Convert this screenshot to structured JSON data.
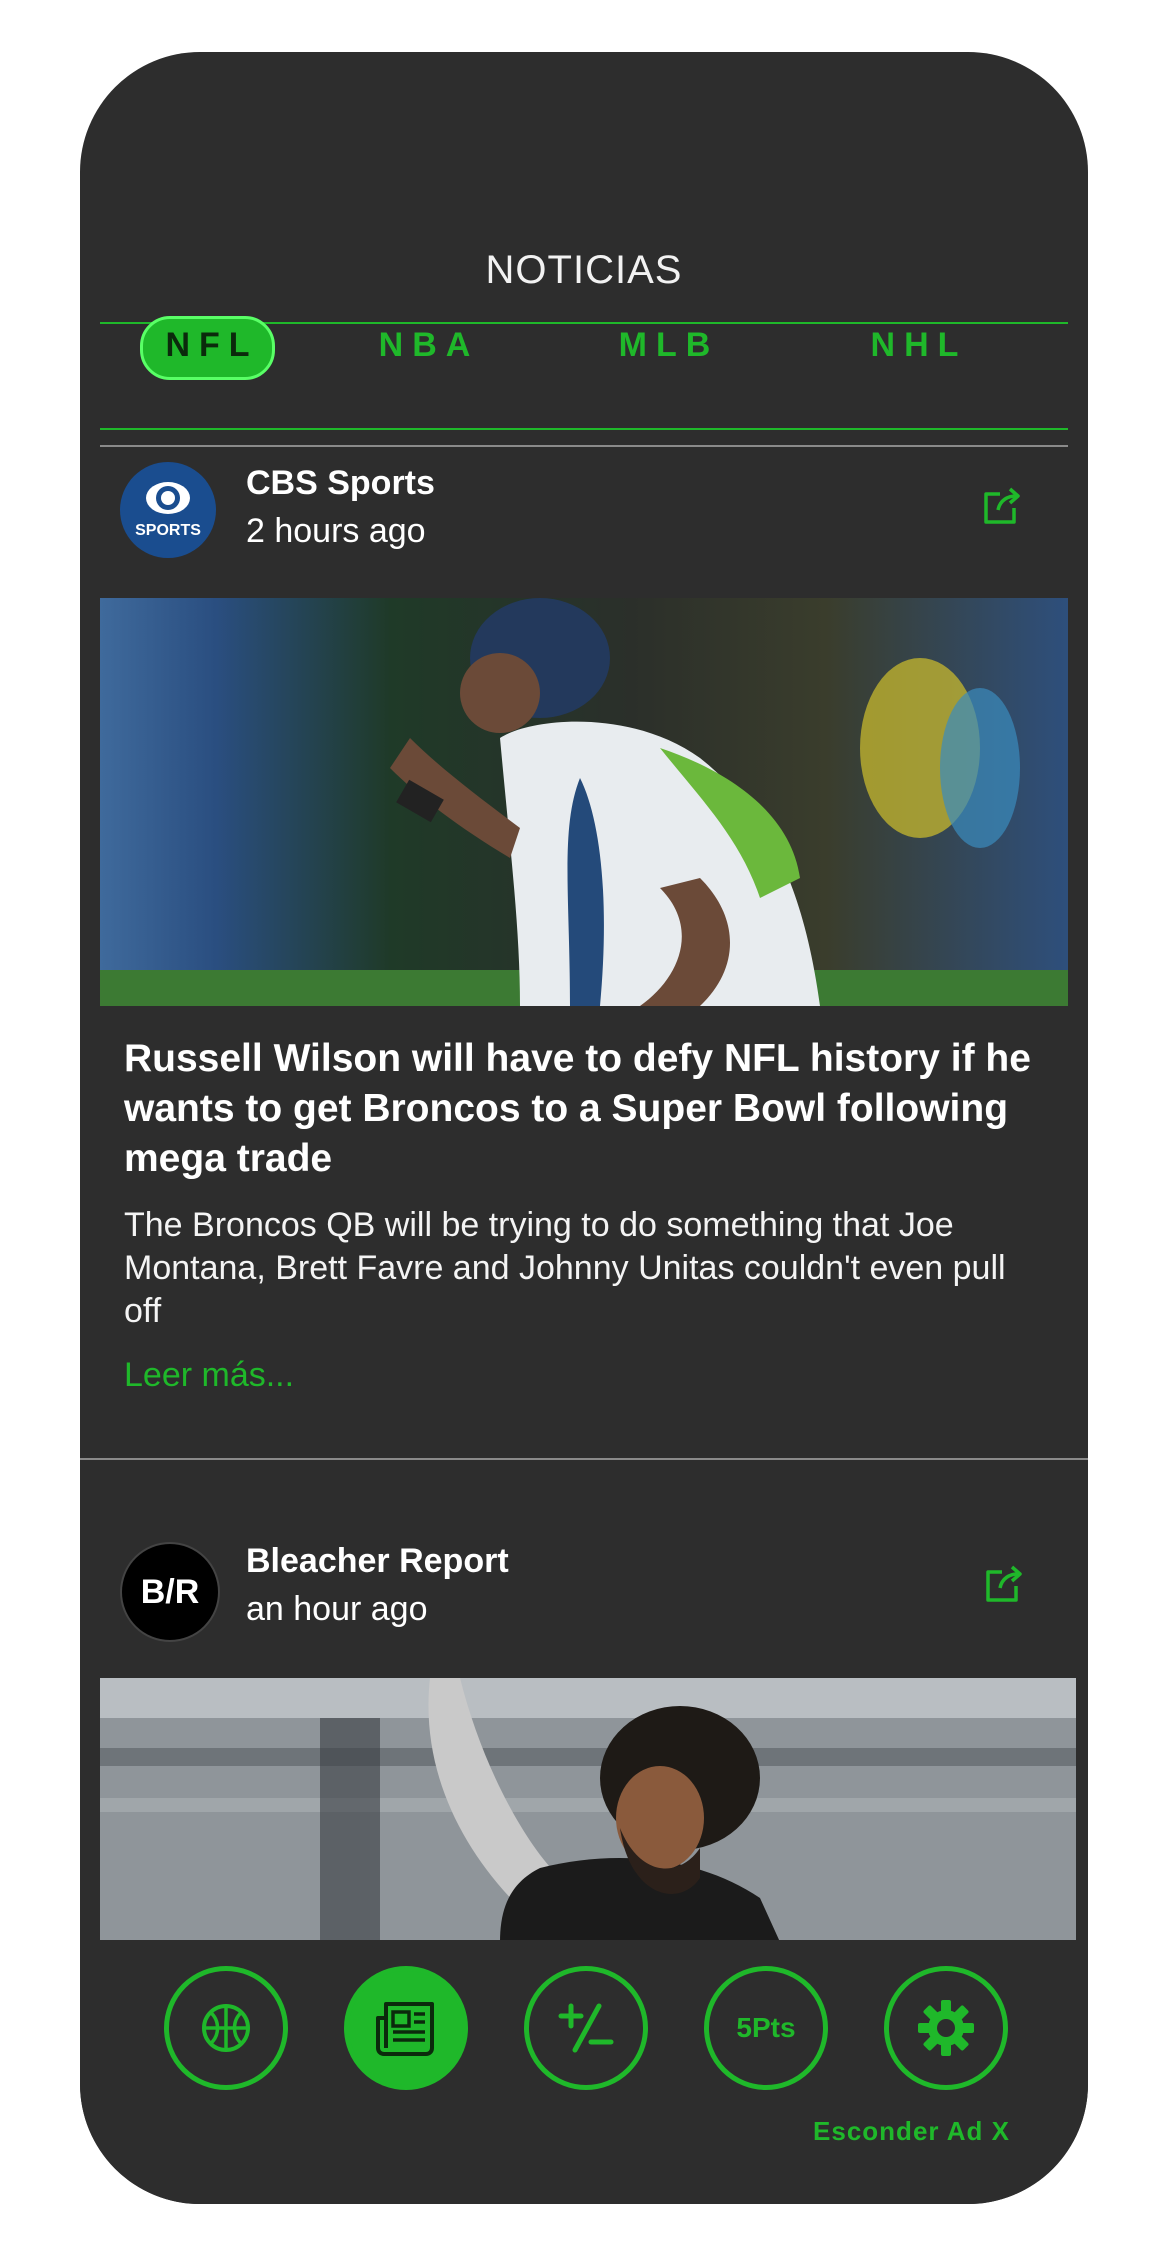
{
  "header": {
    "title": "NOTICIAS"
  },
  "tabs": [
    {
      "label": "NFL",
      "active": true
    },
    {
      "label": "NBA",
      "active": false
    },
    {
      "label": "MLB",
      "active": false
    },
    {
      "label": "NHL",
      "active": false
    }
  ],
  "posts": [
    {
      "source": "CBS Sports",
      "logo_text": "SPORTS",
      "time": "2 hours ago",
      "headline": "Russell Wilson will have to defy NFL history if he wants to get Broncos to a Super Bowl following mega trade",
      "summary": "The Broncos QB will be trying to do something that Joe Montana, Brett Favre and Johnny Unitas couldn't even pull off",
      "read_more": "Leer más..."
    },
    {
      "source": "Bleacher Report",
      "logo_text": "B/R",
      "time": "an hour ago"
    }
  ],
  "bottom_nav": {
    "items": [
      {
        "icon": "basketball-icon"
      },
      {
        "icon": "newspaper-icon",
        "active": true
      },
      {
        "icon": "plus-minus-icon"
      },
      {
        "icon": "points-icon",
        "label": "5Pts"
      },
      {
        "icon": "gear-icon"
      }
    ],
    "hide_ad": "Esconder Ad X"
  },
  "colors": {
    "accent": "#1fb82a",
    "background": "#2d2d2d",
    "text": "#ffffff"
  }
}
